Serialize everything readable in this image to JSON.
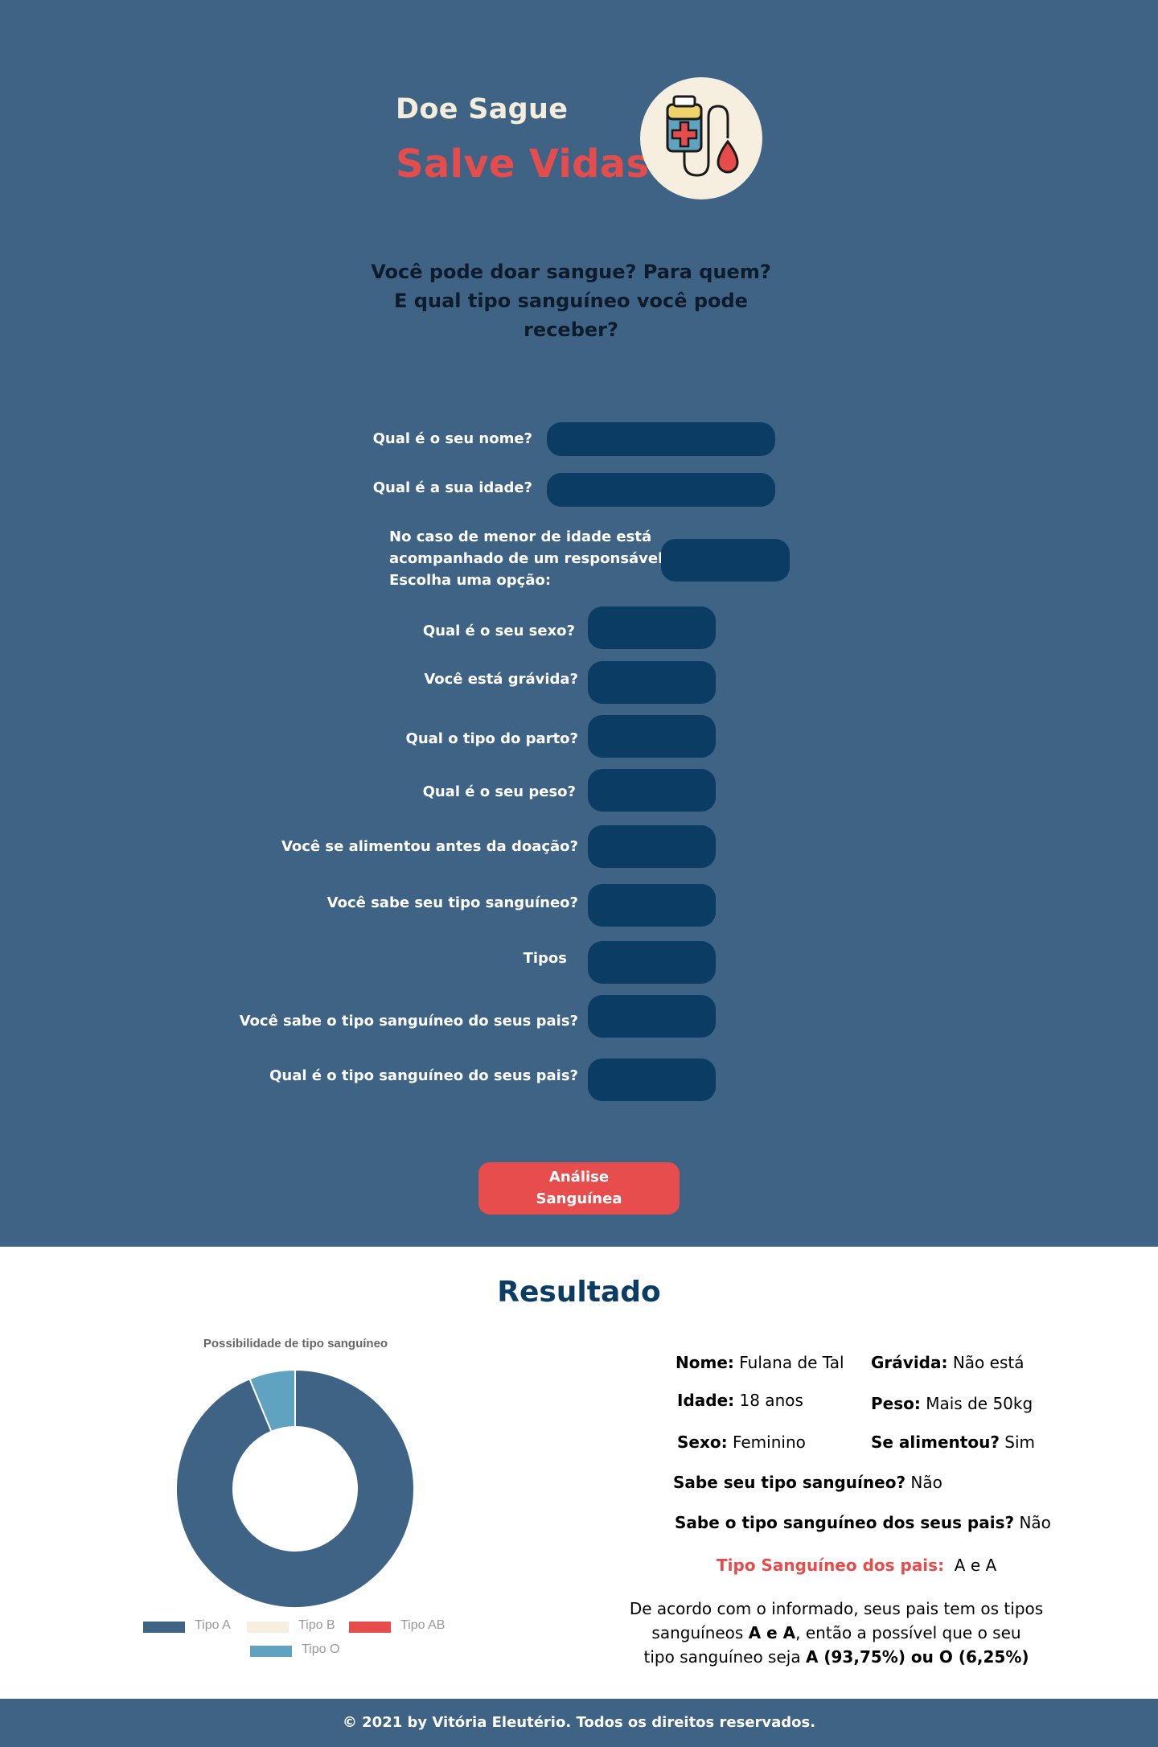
{
  "header": {
    "brand_line1": "Doe Sague",
    "brand_line2": "Salve Vidas",
    "logo_icon": "blood-bag-icon"
  },
  "intro": {
    "line1": "Você pode doar sangue? Para quem?",
    "line2": "E qual tipo sanguíneo você pode",
    "line3": "receber?"
  },
  "form": {
    "name_label": "Qual é o seu nome?",
    "age_label": "Qual é a sua idade?",
    "minor_line1": "No caso de menor de idade está",
    "minor_line2": "acompanhado de um responsável?",
    "minor_line3": "Escolha uma opção:",
    "sex_label": "Qual é o seu sexo?",
    "pregnant_label": "Você está grávida?",
    "birth_label": "Qual o tipo do parto?",
    "weight_label": "Qual é o seu peso?",
    "fed_label": "Você se alimentou antes da doação?",
    "knows_type_label": "Você sabe seu tipo sanguíneo?",
    "types_label": "Tipos",
    "knows_parents_label": "Você sabe o tipo sanguíneo do seus pais?",
    "parents_type_label": "Qual é o tipo sanguíneo do seus pais?",
    "submit_line1": "Análise",
    "submit_line2": "Sanguínea"
  },
  "result": {
    "title": "Resultado",
    "name_key": "Nome:",
    "name_val": "Fulana de Tal",
    "pregnant_key": "Grávida:",
    "pregnant_val": "Não está",
    "age_key": "Idade:",
    "age_val": "18 anos",
    "weight_key": "Peso:",
    "weight_val": "Mais de 50kg",
    "sex_key": "Sexo:",
    "sex_val": "Feminino",
    "fed_key": "Se alimentou?",
    "fed_val": "Sim",
    "knows_type_key": "Sabe seu tipo sanguíneo?",
    "knows_type_val": "Não",
    "knows_parents_key": "Sabe o tipo sanguíneo dos seus pais?",
    "knows_parents_val": "Não",
    "parents_type_key": "Tipo Sanguíneo dos pais:",
    "parents_type_val": "A e A",
    "summary_p1": "De acordo com o informado, seus pais tem os tipos",
    "summary_p2": "sanguíneos ",
    "summary_b1": "A e A",
    "summary_p3": ", então a possível que o seu",
    "summary_p4": "tipo sanguíneo seja ",
    "summary_b2": "A (93,75%) ou O (6,25%)"
  },
  "chart_data": {
    "type": "pie",
    "title": "Possibilidade de tipo sanguíneo",
    "categories": [
      "Tipo A",
      "Tipo B",
      "Tipo AB",
      "Tipo O"
    ],
    "values": [
      93.75,
      0,
      0,
      6.25
    ],
    "colors": [
      "#3e6385",
      "#f6efdf",
      "#e74c4c",
      "#5fa3c0"
    ],
    "donut": true,
    "legend_position": "bottom"
  },
  "footer": {
    "text": "© 2021 by Vitória Eleutério. Todos os direitos reservados."
  }
}
